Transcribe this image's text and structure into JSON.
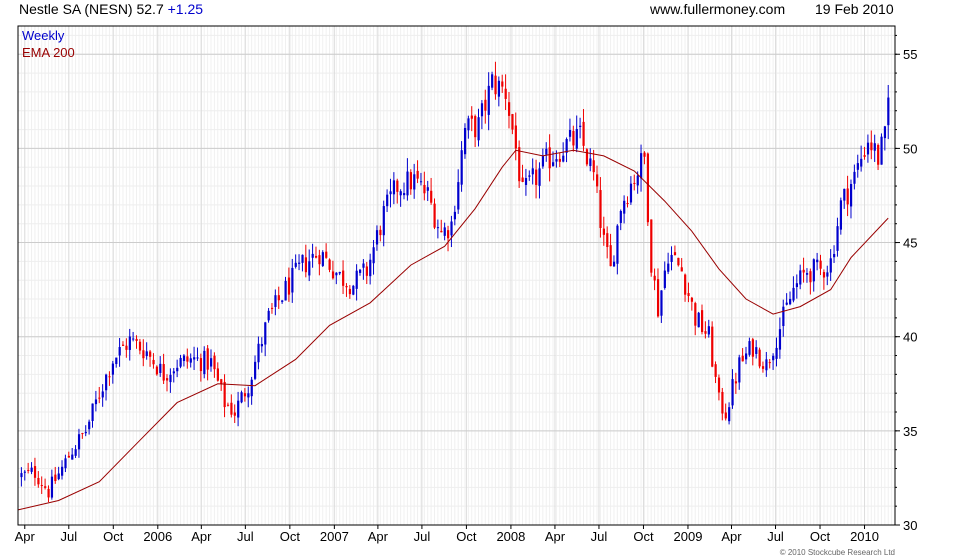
{
  "header": {
    "instrument": "Nestle SA (NESN)",
    "last": "52.7",
    "change": "+1.25",
    "source": "www.fullermoney.com",
    "date": "19 Feb 2010"
  },
  "copyright": "© 2010 Stockcube Research Ltd",
  "colors": {
    "up": "#0000cc",
    "down": "#ee0000",
    "ema": "#990000",
    "grid": "#dddddd"
  },
  "chart_data": {
    "type": "candlestick",
    "frequency": "Weekly",
    "legend": [
      {
        "label": "Weekly",
        "color": "#0000cc"
      },
      {
        "label": "EMA 200",
        "color": "#990000"
      }
    ],
    "legend_position": "top-left",
    "y_axis": {
      "side": "right",
      "ticks": [
        30,
        35,
        40,
        45,
        50,
        55
      ],
      "range": [
        30,
        56.5
      ]
    },
    "x_axis": {
      "range": [
        "2005-03-18",
        "2010-03-05"
      ],
      "ticks": [
        {
          "label": "Apr",
          "date": "2005-04-01"
        },
        {
          "label": "Jul",
          "date": "2005-07-01"
        },
        {
          "label": "Oct",
          "date": "2005-10-01"
        },
        {
          "label": "2006",
          "date": "2006-01-01"
        },
        {
          "label": "Apr",
          "date": "2006-04-01"
        },
        {
          "label": "Jul",
          "date": "2006-07-01"
        },
        {
          "label": "Oct",
          "date": "2006-10-01"
        },
        {
          "label": "2007",
          "date": "2007-01-01"
        },
        {
          "label": "Apr",
          "date": "2007-04-01"
        },
        {
          "label": "Jul",
          "date": "2007-07-01"
        },
        {
          "label": "Oct",
          "date": "2007-10-01"
        },
        {
          "label": "2008",
          "date": "2008-01-01"
        },
        {
          "label": "Apr",
          "date": "2008-04-01"
        },
        {
          "label": "Jul",
          "date": "2008-07-01"
        },
        {
          "label": "Oct",
          "date": "2008-10-01"
        },
        {
          "label": "2009",
          "date": "2009-01-01"
        },
        {
          "label": "Apr",
          "date": "2009-04-01"
        },
        {
          "label": "Jul",
          "date": "2009-07-01"
        },
        {
          "label": "Oct",
          "date": "2009-10-01"
        },
        {
          "label": "2010",
          "date": "2010-01-01"
        }
      ]
    },
    "grid": true,
    "price_path": [
      [
        "2005-03-25",
        32.6
      ],
      [
        "2005-04-22",
        32.8
      ],
      [
        "2005-05-20",
        31.8
      ],
      [
        "2005-06-17",
        33.0
      ],
      [
        "2005-07-08",
        34.0
      ],
      [
        "2005-08-05",
        35.0
      ],
      [
        "2005-09-02",
        37.0
      ],
      [
        "2005-09-30",
        38.8
      ],
      [
        "2005-11-04",
        39.8
      ],
      [
        "2005-12-09",
        39.2
      ],
      [
        "2006-01-13",
        38.0
      ],
      [
        "2006-02-10",
        38.6
      ],
      [
        "2006-03-17",
        38.8
      ],
      [
        "2006-04-21",
        38.6
      ],
      [
        "2006-05-19",
        36.5
      ],
      [
        "2006-06-09",
        36.0
      ],
      [
        "2006-07-07",
        37.5
      ],
      [
        "2006-08-18",
        41.0
      ],
      [
        "2006-09-22",
        42.5
      ],
      [
        "2006-10-27",
        43.8
      ],
      [
        "2006-12-01",
        44.5
      ],
      [
        "2007-01-12",
        43.2
      ],
      [
        "2007-02-09",
        42.8
      ],
      [
        "2007-03-09",
        43.5
      ],
      [
        "2007-04-13",
        46.5
      ],
      [
        "2007-05-11",
        48.0
      ],
      [
        "2007-06-15",
        48.3
      ],
      [
        "2007-07-13",
        47.5
      ],
      [
        "2007-08-10",
        45.5
      ],
      [
        "2007-08-31",
        46.0
      ],
      [
        "2007-09-28",
        51.0
      ],
      [
        "2007-10-26",
        51.2
      ],
      [
        "2007-11-23",
        53.5
      ],
      [
        "2007-12-21",
        53.0
      ],
      [
        "2008-01-11",
        50.0
      ],
      [
        "2008-01-25",
        47.5
      ],
      [
        "2008-02-22",
        48.5
      ],
      [
        "2008-03-21",
        49.5
      ],
      [
        "2008-04-25",
        50.2
      ],
      [
        "2008-05-23",
        50.6
      ],
      [
        "2008-06-20",
        48.5
      ],
      [
        "2008-07-11",
        45.0
      ],
      [
        "2008-07-25",
        43.5
      ],
      [
        "2008-08-15",
        47.0
      ],
      [
        "2008-09-12",
        48.5
      ],
      [
        "2008-10-03",
        49.5
      ],
      [
        "2008-10-17",
        44.0
      ],
      [
        "2008-10-31",
        41.5
      ],
      [
        "2008-11-21",
        44.5
      ],
      [
        "2008-12-19",
        43.5
      ],
      [
        "2009-01-16",
        41.0
      ],
      [
        "2009-02-13",
        40.0
      ],
      [
        "2009-03-06",
        36.5
      ],
      [
        "2009-03-20",
        36.0
      ],
      [
        "2009-04-17",
        38.5
      ],
      [
        "2009-05-15",
        39.5
      ],
      [
        "2009-06-12",
        38.5
      ],
      [
        "2009-07-10",
        40.5
      ],
      [
        "2009-08-07",
        42.5
      ],
      [
        "2009-09-04",
        43.5
      ],
      [
        "2009-10-02",
        43.5
      ],
      [
        "2009-10-23",
        44.0
      ],
      [
        "2009-11-13",
        47.0
      ],
      [
        "2009-12-11",
        48.5
      ],
      [
        "2010-01-08",
        50.5
      ],
      [
        "2010-01-29",
        49.5
      ],
      [
        "2010-02-12",
        50.5
      ],
      [
        "2010-02-19",
        52.7
      ]
    ],
    "ema200": [
      [
        "2005-03-18",
        30.8
      ],
      [
        "2005-06-10",
        31.3
      ],
      [
        "2005-09-02",
        32.3
      ],
      [
        "2005-11-25",
        34.5
      ],
      [
        "2006-02-10",
        36.5
      ],
      [
        "2006-05-05",
        37.5
      ],
      [
        "2006-07-21",
        37.4
      ],
      [
        "2006-10-13",
        38.8
      ],
      [
        "2006-12-22",
        40.6
      ],
      [
        "2007-03-16",
        41.8
      ],
      [
        "2007-06-08",
        43.8
      ],
      [
        "2007-08-17",
        44.8
      ],
      [
        "2007-10-19",
        46.8
      ],
      [
        "2007-12-14",
        49.0
      ],
      [
        "2008-01-11",
        49.9
      ],
      [
        "2008-03-07",
        49.6
      ],
      [
        "2008-05-09",
        49.9
      ],
      [
        "2008-07-11",
        49.6
      ],
      [
        "2008-09-12",
        48.8
      ],
      [
        "2008-11-14",
        47.2
      ],
      [
        "2009-01-09",
        45.6
      ],
      [
        "2009-03-06",
        43.6
      ],
      [
        "2009-05-01",
        42.0
      ],
      [
        "2009-06-26",
        41.2
      ],
      [
        "2009-08-21",
        41.6
      ],
      [
        "2009-10-23",
        42.5
      ],
      [
        "2009-12-04",
        44.2
      ],
      [
        "2010-02-19",
        46.3
      ]
    ]
  }
}
